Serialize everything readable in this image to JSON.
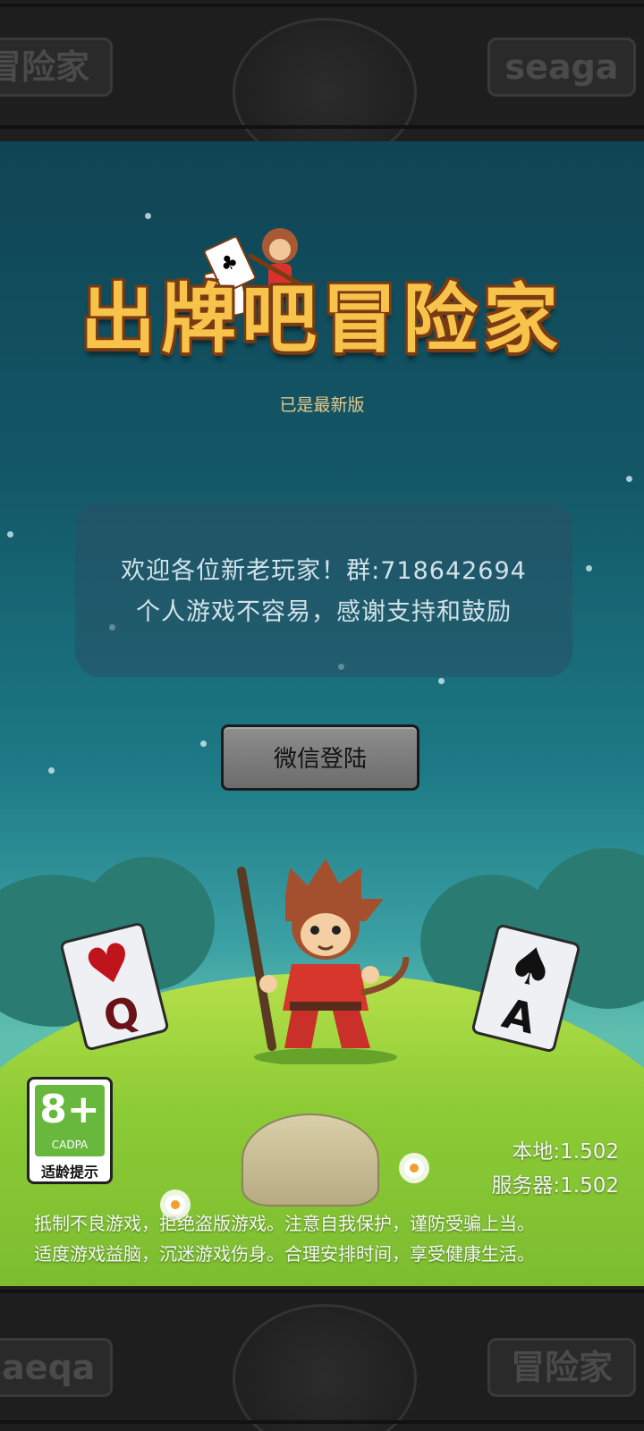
{
  "app": {
    "version_status": "已是最新版",
    "notice": {
      "line1": "欢迎各位新老玩家！群:718642694",
      "line2": "个人游戏不容易，感谢支持和鼓励"
    },
    "login_button": "微信登陆",
    "age_rating": {
      "value": "8+",
      "org": "CADPA",
      "label": "适龄提示"
    },
    "versions": {
      "local": "本地:1.502",
      "server": "服务器:1.502"
    },
    "health_notice": {
      "line1": "抵制不良游戏，拒绝盗版游戏。注意自我保护，谨防受骗上当。",
      "line2": "适度游戏益脑，沉迷游戏伤身。合理安排时间，享受健康生活。"
    },
    "cards": {
      "left": {
        "suit": "♥",
        "rank": "Q",
        "color": "#c0141c"
      },
      "right": {
        "suit": "♠",
        "rank": "A",
        "color": "#111111"
      }
    }
  },
  "logo": {
    "title": "出牌吧冒险家",
    "colors": {
      "fill": "#f7c34a",
      "outline": "#7a3a12"
    }
  },
  "decor": {
    "top_band_text_left": "冒险家",
    "top_band_text_right": "seaga",
    "bottom_band_text_left": "saeqa",
    "bottom_band_text_right": "冒险家"
  },
  "colors": {
    "sky_top": "#0f4454",
    "grass": "#8dcb35",
    "button": "#7d7d7d",
    "age_green": "#67b83c"
  }
}
